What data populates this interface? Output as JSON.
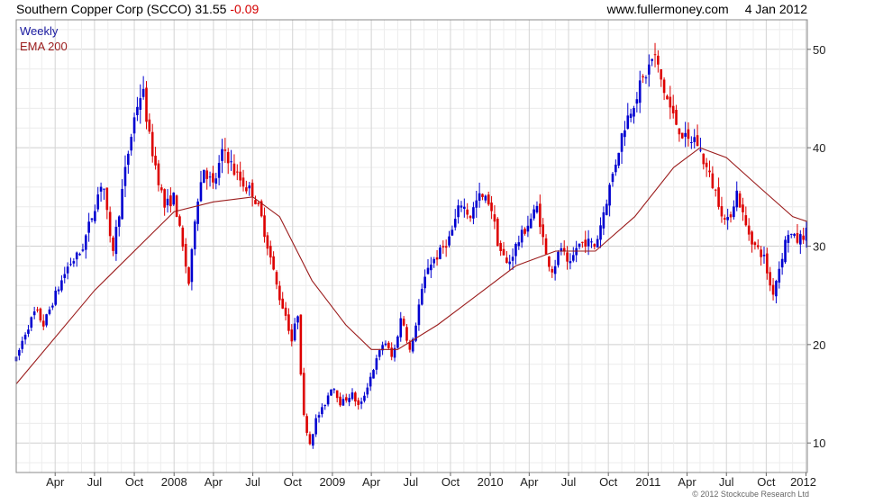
{
  "header": {
    "title": "Southern Copper Corp (SCCO)",
    "last_price": "31.55",
    "change": "-0.09",
    "website": "www.fullermoney.com",
    "date": "4 Jan 2012"
  },
  "footer": {
    "copyright": "© 2012 Stockcube Research Ltd"
  },
  "colors": {
    "up": "#0000d0",
    "down": "#dd0000",
    "ema": "#9b1c1c",
    "grid": "#d6d6d6"
  },
  "chart_data": {
    "type": "candlestick",
    "title": "Southern Copper Corp (SCCO) 31.55 -0.09",
    "frequency": "Weekly",
    "legend": [
      "Weekly",
      "EMA 200"
    ],
    "legend_placement": "top-left",
    "y_axis": {
      "side": "right",
      "ylim": [
        7,
        53
      ],
      "ticks": [
        10,
        20,
        30,
        40,
        50
      ]
    },
    "x_axis": {
      "range": [
        "2007-01-01",
        "2012-01-04"
      ],
      "ticks": [
        {
          "label": "Apr",
          "date": "2007-04-01"
        },
        {
          "label": "Jul",
          "date": "2007-07-01"
        },
        {
          "label": "Oct",
          "date": "2007-10-01"
        },
        {
          "label": "2008",
          "date": "2008-01-01"
        },
        {
          "label": "Apr",
          "date": "2008-04-01"
        },
        {
          "label": "Jul",
          "date": "2008-07-01"
        },
        {
          "label": "Oct",
          "date": "2008-10-01"
        },
        {
          "label": "2009",
          "date": "2009-01-01"
        },
        {
          "label": "Apr",
          "date": "2009-04-01"
        },
        {
          "label": "Jul",
          "date": "2009-07-01"
        },
        {
          "label": "Oct",
          "date": "2009-10-01"
        },
        {
          "label": "2010",
          "date": "2010-01-01"
        },
        {
          "label": "Apr",
          "date": "2010-04-01"
        },
        {
          "label": "Jul",
          "date": "2010-07-01"
        },
        {
          "label": "Oct",
          "date": "2010-10-01"
        },
        {
          "label": "2011",
          "date": "2011-01-01"
        },
        {
          "label": "Apr",
          "date": "2011-04-01"
        },
        {
          "label": "Jul",
          "date": "2011-07-01"
        },
        {
          "label": "Oct",
          "date": "2011-10-01"
        },
        {
          "label": "2012",
          "date": "2012-01-01"
        }
      ]
    },
    "grid": true,
    "price_path": [
      [
        "2007-01-01",
        18.5
      ],
      [
        "2007-01-20",
        21
      ],
      [
        "2007-02-15",
        23.5
      ],
      [
        "2007-03-05",
        22
      ],
      [
        "2007-04-01",
        25
      ],
      [
        "2007-05-01",
        28
      ],
      [
        "2007-06-01",
        29.5
      ],
      [
        "2007-07-01",
        34
      ],
      [
        "2007-07-20",
        37
      ],
      [
        "2007-08-10",
        29
      ],
      [
        "2007-08-25",
        33
      ],
      [
        "2007-09-15",
        39
      ],
      [
        "2007-10-05",
        44
      ],
      [
        "2007-10-20",
        46
      ],
      [
        "2007-11-05",
        41
      ],
      [
        "2007-11-20",
        38
      ],
      [
        "2007-12-10",
        34
      ],
      [
        "2008-01-01",
        35
      ],
      [
        "2008-01-20",
        30
      ],
      [
        "2008-02-05",
        26
      ],
      [
        "2008-02-20",
        34
      ],
      [
        "2008-03-10",
        38
      ],
      [
        "2008-04-01",
        36
      ],
      [
        "2008-04-25",
        40
      ],
      [
        "2008-05-20",
        37.5
      ],
      [
        "2008-06-15",
        36
      ],
      [
        "2008-07-01",
        35.5
      ],
      [
        "2008-07-20",
        33
      ],
      [
        "2008-08-10",
        29
      ],
      [
        "2008-08-30",
        25
      ],
      [
        "2008-09-15",
        23
      ],
      [
        "2008-10-01",
        20
      ],
      [
        "2008-10-12",
        24
      ],
      [
        "2008-10-25",
        13
      ],
      [
        "2008-11-10",
        10
      ],
      [
        "2008-11-25",
        12.5
      ],
      [
        "2008-12-10",
        13.5
      ],
      [
        "2009-01-01",
        16
      ],
      [
        "2009-01-20",
        14
      ],
      [
        "2009-02-15",
        15
      ],
      [
        "2009-03-05",
        13.5
      ],
      [
        "2009-04-01",
        17
      ],
      [
        "2009-05-01",
        20.5
      ],
      [
        "2009-05-20",
        18.5
      ],
      [
        "2009-06-10",
        23
      ],
      [
        "2009-07-01",
        19
      ],
      [
        "2009-07-20",
        24
      ],
      [
        "2009-08-10",
        28
      ],
      [
        "2009-09-01",
        29
      ],
      [
        "2009-10-01",
        31
      ],
      [
        "2009-10-25",
        34.5
      ],
      [
        "2009-11-15",
        33
      ],
      [
        "2009-12-05",
        35
      ],
      [
        "2010-01-01",
        34.5
      ],
      [
        "2010-01-20",
        30
      ],
      [
        "2010-02-10",
        28
      ],
      [
        "2010-03-01",
        30
      ],
      [
        "2010-04-01",
        32.5
      ],
      [
        "2010-04-20",
        34
      ],
      [
        "2010-05-10",
        29
      ],
      [
        "2010-05-25",
        27.5
      ],
      [
        "2010-06-15",
        30
      ],
      [
        "2010-07-01",
        27.5
      ],
      [
        "2010-07-20",
        30
      ],
      [
        "2010-08-10",
        30.5
      ],
      [
        "2010-09-01",
        30
      ],
      [
        "2010-09-20",
        33.5
      ],
      [
        "2010-10-15",
        38
      ],
      [
        "2010-11-05",
        42
      ],
      [
        "2010-12-01",
        45
      ],
      [
        "2011-01-01",
        48
      ],
      [
        "2011-01-15",
        49.5
      ],
      [
        "2011-02-05",
        46
      ],
      [
        "2011-03-01",
        43
      ],
      [
        "2011-04-01",
        40.5
      ],
      [
        "2011-04-20",
        41
      ],
      [
        "2011-05-15",
        38
      ],
      [
        "2011-06-10",
        35
      ],
      [
        "2011-07-01",
        32
      ],
      [
        "2011-07-25",
        35.5
      ],
      [
        "2011-08-15",
        32
      ],
      [
        "2011-09-05",
        30
      ],
      [
        "2011-09-25",
        29
      ],
      [
        "2011-10-05",
        27
      ],
      [
        "2011-10-15",
        25
      ],
      [
        "2011-11-01",
        28
      ],
      [
        "2011-11-20",
        31.5
      ],
      [
        "2011-12-10",
        30.5
      ],
      [
        "2012-01-04",
        31.5
      ]
    ],
    "ema_200": [
      [
        "2007-01-01",
        16
      ],
      [
        "2007-07-01",
        25.5
      ],
      [
        "2008-01-01",
        33.5
      ],
      [
        "2008-04-01",
        34.5
      ],
      [
        "2008-07-01",
        35
      ],
      [
        "2008-09-01",
        33
      ],
      [
        "2008-11-15",
        26.5
      ],
      [
        "2009-02-01",
        22
      ],
      [
        "2009-04-01",
        19.5
      ],
      [
        "2009-06-01",
        19.5
      ],
      [
        "2009-09-01",
        22
      ],
      [
        "2009-12-01",
        25
      ],
      [
        "2010-03-01",
        28
      ],
      [
        "2010-06-01",
        29.5
      ],
      [
        "2010-09-01",
        29.5
      ],
      [
        "2010-12-01",
        33
      ],
      [
        "2011-03-01",
        38
      ],
      [
        "2011-05-01",
        40
      ],
      [
        "2011-07-01",
        39
      ],
      [
        "2011-09-15",
        36
      ],
      [
        "2011-12-01",
        33
      ],
      [
        "2012-01-04",
        32.5
      ]
    ]
  }
}
